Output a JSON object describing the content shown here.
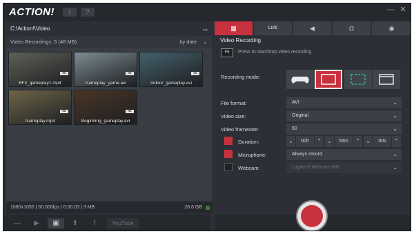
{
  "app": {
    "logo": "ACTION!",
    "info_btn": "i",
    "help_btn": "?",
    "min_btn": "—",
    "close_btn": "✕"
  },
  "left": {
    "path": "C:\\Action!\\Video",
    "path_menu": "...",
    "list_header": "Video Recordings: 5 (48 MB)",
    "sort": "by date",
    "thumbs": [
      {
        "label": "BF3_gameplay1.mp4",
        "color": "#5e6157"
      },
      {
        "label": "Gameplay_game.avi",
        "color": "#7d8c93"
      },
      {
        "label": "Indoor_gameplay.avi",
        "color": "#44606b"
      },
      {
        "label": "Gameplay.mp4",
        "color": "#6f6548"
      },
      {
        "label": "Beginning_gameplay.avi",
        "color": "#4a3525"
      }
    ],
    "status": "1680x1050 | 60.000fps | 0:00:03 | 3 MB",
    "free_space": "28.6 GB",
    "hd_badge": "HD"
  },
  "bottom_left": {
    "minus": "—",
    "play": "▶",
    "camera": "▣",
    "upload": "⬆",
    "facebook": "f",
    "youtube": "YouTube"
  },
  "tabs": [
    "▦",
    "LIVE",
    "◀",
    "⛭",
    "◉",
    "⚙"
  ],
  "video": {
    "title": "Video Recording",
    "fkey": "F9",
    "hint": "Press to start/stop video recording",
    "mode_label": "Recording mode:",
    "file_format_label": "File format:",
    "file_format": "AVI",
    "video_size_label": "Video size:",
    "video_size": "Original",
    "framerate_label": "Video framerate:",
    "framerate": "60",
    "duration_label": "Duration:",
    "duration_h": "00h",
    "duration_m": "54m",
    "duration_s": "00s",
    "mic_label": "Microphone:",
    "mic": "Always record",
    "webcam_label": "Webcam:",
    "webcam": "Logitech Webcam 600"
  }
}
